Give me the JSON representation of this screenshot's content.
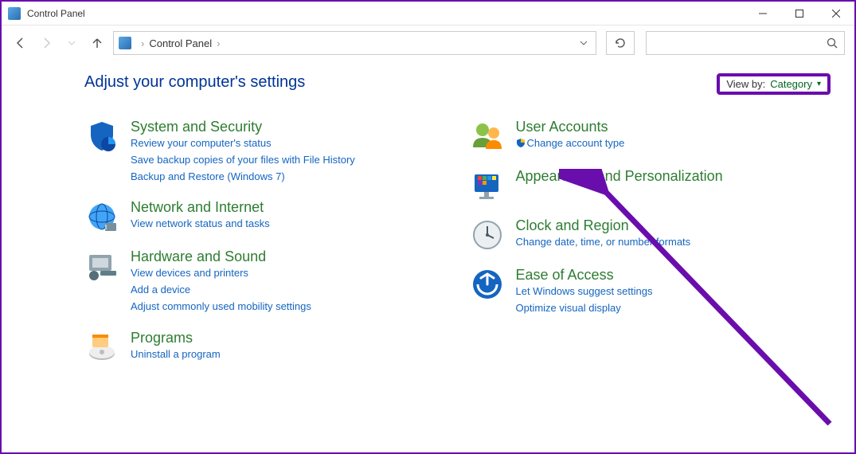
{
  "window": {
    "title": "Control Panel"
  },
  "address": {
    "location": "Control Panel"
  },
  "heading": "Adjust your computer's settings",
  "viewby": {
    "label": "View by:",
    "value": "Category"
  },
  "left": {
    "system": {
      "title": "System and Security",
      "links": [
        "Review your computer's status",
        "Save backup copies of your files with File History",
        "Backup and Restore (Windows 7)"
      ]
    },
    "network": {
      "title": "Network and Internet",
      "links": [
        "View network status and tasks"
      ]
    },
    "hardware": {
      "title": "Hardware and Sound",
      "links": [
        "View devices and printers",
        "Add a device",
        "Adjust commonly used mobility settings"
      ]
    },
    "programs": {
      "title": "Programs",
      "links": [
        "Uninstall a program"
      ]
    }
  },
  "right": {
    "users": {
      "title": "User Accounts",
      "links": [
        "Change account type"
      ]
    },
    "appearance": {
      "title": "Appearance and Personalization"
    },
    "clock": {
      "title": "Clock and Region",
      "links": [
        "Change date, time, or number formats"
      ]
    },
    "ease": {
      "title": "Ease of Access",
      "links": [
        "Let Windows suggest settings",
        "Optimize visual display"
      ]
    }
  }
}
